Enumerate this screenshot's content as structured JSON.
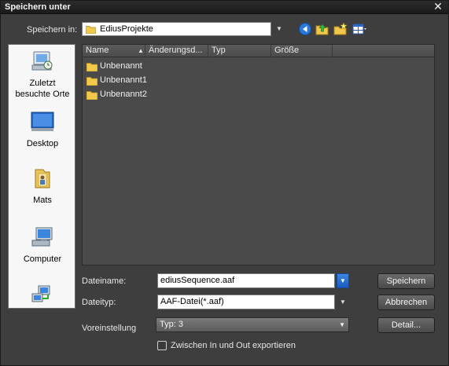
{
  "window": {
    "title": "Speichern unter",
    "close": "✕"
  },
  "location": {
    "label": "Speichern in:",
    "current_folder": "EdiusProjekte"
  },
  "places": [
    {
      "line1": "Zuletzt",
      "line2": "besuchte Orte"
    },
    {
      "line1": "Desktop",
      "line2": ""
    },
    {
      "line1": "Mats",
      "line2": ""
    },
    {
      "line1": "Computer",
      "line2": ""
    },
    {
      "line1": "",
      "line2": ""
    }
  ],
  "columns": {
    "name": "Name",
    "date": "Änderungsd...",
    "type": "Typ",
    "size": "Größe"
  },
  "files": [
    {
      "name": "Unbenannt"
    },
    {
      "name": "Unbenannt1"
    },
    {
      "name": "Unbenannt2"
    }
  ],
  "filename": {
    "label": "Dateiname:",
    "value": "ediusSequence.aaf"
  },
  "filetype": {
    "label": "Dateityp:",
    "value": "AAF-Datei(*.aaf)"
  },
  "preset": {
    "label": "Voreinstellung",
    "value": "Typ: 3"
  },
  "export_option": {
    "label": "Zwischen In und Out exportieren",
    "checked": false
  },
  "buttons": {
    "save": "Speichern",
    "cancel": "Abbrechen",
    "detail": "Detail..."
  },
  "colors": {
    "window_bg": "#3e3e3e",
    "list_bg": "#4a4a4a",
    "accent": "#1a5cc0"
  }
}
